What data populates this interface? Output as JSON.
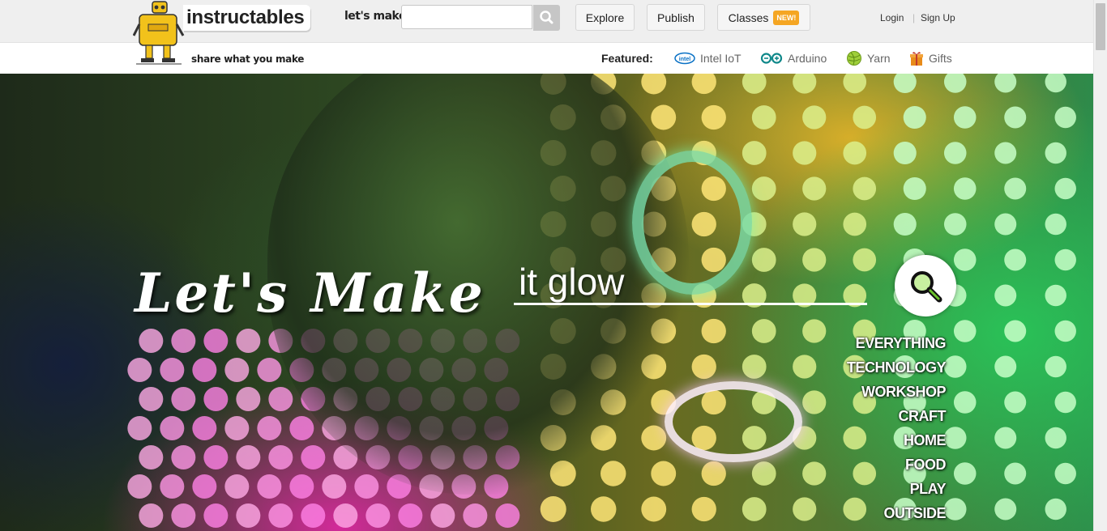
{
  "header": {
    "logo_text": "instructables",
    "tagline": "share what you make",
    "lets_make_label": "let's make",
    "search_placeholder": "",
    "nav": {
      "explore": "Explore",
      "publish": "Publish",
      "classes": "Classes",
      "classes_badge": "NEW!"
    },
    "login": "Login",
    "separator": "|",
    "signup": "Sign Up"
  },
  "featured": {
    "label": "Featured:",
    "items": [
      {
        "label": "Intel IoT",
        "icon": "intel-icon"
      },
      {
        "label": "Arduino",
        "icon": "arduino-icon"
      },
      {
        "label": "Yarn",
        "icon": "yarn-icon"
      },
      {
        "label": "Gifts",
        "icon": "gift-icon"
      }
    ]
  },
  "hero": {
    "title": "Let's Make",
    "search_value": "it glow",
    "categories": [
      "EVERYTHING",
      "TECHNOLOGY",
      "WORKSHOP",
      "CRAFT",
      "HOME",
      "FOOD",
      "PLAY",
      "OUTSIDE"
    ]
  },
  "colors": {
    "badge": "#f5a623",
    "topbar": "#efefef",
    "search_button": "#c6c6c6"
  }
}
